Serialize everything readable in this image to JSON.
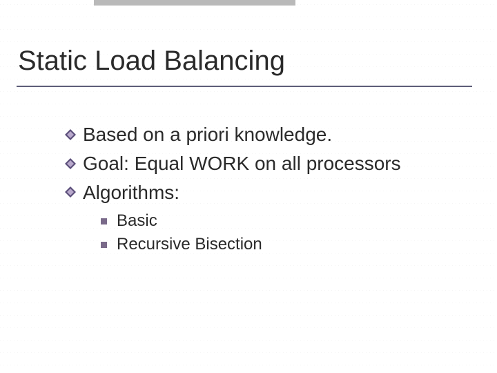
{
  "title": "Static Load Balancing",
  "bullets": [
    {
      "text": "Based on a priori knowledge."
    },
    {
      "text": "Goal: Equal WORK on all processors"
    },
    {
      "text": "Algorithms:"
    }
  ],
  "sub_bullets": [
    {
      "text": "Basic"
    },
    {
      "text": "Recursive Bisection"
    }
  ],
  "colors": {
    "diamond_outer": "#5b4e7a",
    "diamond_inner": "#b9a9cc",
    "square": "#7a6a8a",
    "underline": "#5d5d78"
  }
}
